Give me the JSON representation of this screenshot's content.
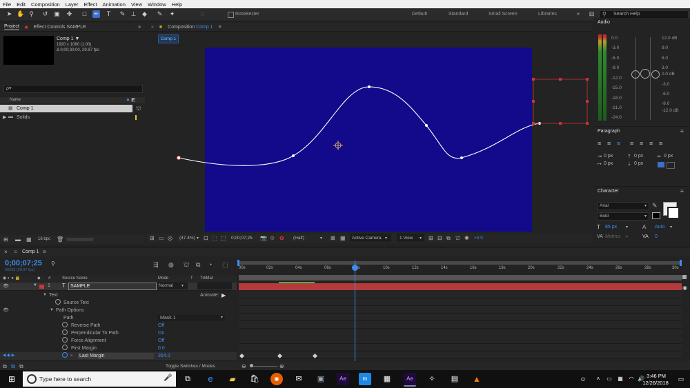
{
  "menu": [
    "File",
    "Edit",
    "Composition",
    "Layer",
    "Effect",
    "Animation",
    "View",
    "Window",
    "Help"
  ],
  "toolbar": {
    "rotobezier": "RotoBezier",
    "workspaces": [
      "Default",
      "Standard",
      "Small Screen",
      "Libraries"
    ],
    "search_placeholder": "Search Help"
  },
  "project": {
    "tab_project": "Project",
    "tab_effects": "Effect Controls SAMPLE",
    "comp_name": "Comp 1 ▼",
    "comp_size": "1920 x 1080 (1.00)",
    "comp_dur": "Δ 0;00;30;00, 29.97 fps",
    "search_icon": "ρ▾",
    "col_name": "Name",
    "items": [
      {
        "name": "Comp 1"
      },
      {
        "name": "Solids"
      }
    ],
    "bpc": "16 bpc"
  },
  "comp": {
    "title_prefix": "Composition",
    "title_name": "Comp 1",
    "tab": "Comp 1",
    "zoom": "(47.4%)",
    "time": "0;00;07;25",
    "res": "(Half)",
    "camera": "Active Camera",
    "views": "1 View",
    "exposure": "+0.0"
  },
  "audio": {
    "title": "Audio",
    "left_db": [
      "0.0",
      "-3.0",
      "-6.0",
      "-9.0",
      "-12.0",
      "-15.0",
      "-18.0",
      "-21.0",
      "-24.0"
    ],
    "right_db": [
      "12.0 dB",
      "9.0",
      "6.0",
      "3.0",
      "0.0 dB",
      "-3.0",
      "-6.0",
      "-9.0",
      "-12.0 dB"
    ]
  },
  "paragraph": {
    "title": "Paragraph",
    "fields": [
      "0 px",
      "0 px",
      "0 px",
      "0 px",
      "0 px"
    ]
  },
  "character": {
    "title": "Character",
    "font": "Arial",
    "style": "Bold",
    "size": "85 px",
    "leading": "Auto",
    "kerning": "Metrics",
    "tracking": "0"
  },
  "timeline": {
    "tab": "Comp 1",
    "time": "0;00;07;25",
    "time_sub": "00235 (29.97 fps)",
    "col_num": "#",
    "col_source": "Source Name",
    "col_mode": "Mode",
    "col_t": "T",
    "col_trkmat": "TrkMat",
    "layer_num": "1",
    "layer_name": "SAMPLE",
    "layer_mode": "Normal",
    "animate": "Animate:",
    "props": [
      {
        "label": "Text",
        "value": ""
      },
      {
        "label": "Source Text",
        "value": ""
      },
      {
        "label": "Path Options",
        "value": ""
      },
      {
        "label": "Path",
        "value": "Mask 1"
      },
      {
        "label": "Reverse Path",
        "value": "Off"
      },
      {
        "label": "Perpendicular To Path",
        "value": "On"
      },
      {
        "label": "Force Alignment",
        "value": "Off"
      },
      {
        "label": "First Margin",
        "value": "0.0"
      },
      {
        "label": "Last Margin",
        "value": "354.0"
      }
    ],
    "ruler": [
      "00s",
      "02s",
      "04s",
      "06s",
      "08s",
      "10s",
      "12s",
      "14s",
      "16s",
      "18s",
      "20s",
      "22s",
      "24s",
      "26s",
      "28s",
      "30s"
    ],
    "toggle": "Toggle Switches / Modes"
  },
  "taskbar": {
    "search": "Type here to search",
    "time": "3:46 PM",
    "date": "12/26/2018"
  }
}
